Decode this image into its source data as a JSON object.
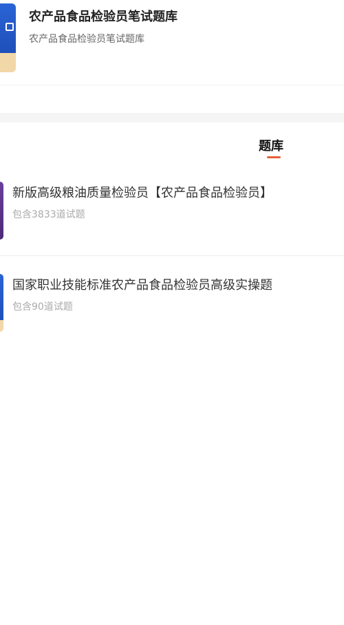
{
  "header": {
    "title": "农产品食品检验员笔试题库",
    "subtitle": "农产品食品检验员笔试题库",
    "cover_icon": "cart-icon"
  },
  "tabs": [
    {
      "label": "题库",
      "active": true
    }
  ],
  "colors": {
    "accent": "#e6603b",
    "cover_blue": "#2a64d6",
    "cover_purple": "#6a3d9a"
  },
  "question_banks": [
    {
      "title": "新版高级粮油质量检验员【农产品食品检验员】",
      "count_text": "包含3833道试题"
    },
    {
      "title": "国家职业技能标准农产品食品检验员高级实操题",
      "count_text": "包含90道试题"
    }
  ]
}
